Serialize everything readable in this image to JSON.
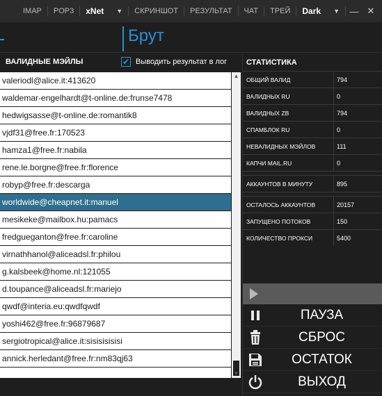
{
  "topbar": {
    "items": [
      "IMAP",
      "POP3"
    ],
    "selected_app": "xNet",
    "items2": [
      "СКРИНШОТ",
      "РЕЗУЛЬТАТ",
      "ЧАТ",
      "ТРЕЙ"
    ],
    "theme": "Dark",
    "minimize": "—",
    "close": "✕"
  },
  "header": {
    "title": "Брут"
  },
  "left": {
    "label": "ВАЛИДНЫЕ МЭЙЛЫ",
    "checkbox_label": "Выводить результат в лог",
    "checkbox_checked": true,
    "rows": [
      "valeriodl@alice.it:413620",
      "waldemar-engelhardt@t-online.de:frunse7478",
      "hedwigsasse@t-online.de:romantik8",
      "vjdf31@free.fr:170523",
      "hamza1@free.fr:nabila",
      "rene.le.borgne@free.fr:florence",
      "robyp@free.fr:descarga",
      "worldwide@cheapnet.it:manuel",
      "mesikeke@mailbox.hu:pamacs",
      "fredgueganton@free.fr:caroline",
      "virnathhanol@aliceadsl.fr:philou",
      "g.kalsbeek@home.nl:121055",
      "d.toupance@aliceadsl.fr:mariejo",
      "qwdf@interia.eu:qwdfqwdf",
      "yoshi462@free.fr:96879687",
      "sergiotropical@alice.it:sisisisisisi",
      "annick.herledant@free.fr:nm83qj63"
    ],
    "selected_index": 7
  },
  "stats": {
    "title": "СТАТИСТИКА",
    "items": [
      {
        "k": "ОБЩИЙ ВАЛИД",
        "v": "794"
      },
      {
        "k": "ВАЛИДНЫХ RU",
        "v": "0"
      },
      {
        "k": "ВАЛИДНЫХ ZB",
        "v": "794"
      },
      {
        "k": "СПАМБЛОК RU",
        "v": "0"
      },
      {
        "k": "НЕВАЛИДНЫХ МЭЙЛОВ",
        "v": "111"
      },
      {
        "k": "КАПЧИ MAIL.RU",
        "v": "0"
      }
    ],
    "items2": [
      {
        "k": "АККАУНТОВ В МИНУТУ",
        "v": "895"
      }
    ],
    "items3": [
      {
        "k": "ОСТАЛОСЬ АККАУНТОВ",
        "v": "20157"
      },
      {
        "k": "ЗАПУЩЕНО ПОТОКОВ",
        "v": "150"
      },
      {
        "k": "КОЛИЧЕСТВО ПРОКСИ",
        "v": "5400"
      }
    ]
  },
  "buttons": {
    "pause": "ПАУЗА",
    "reset": "СБРОС",
    "remainder": "ОСТАТОК",
    "exit": "ВЫХОД"
  },
  "colors": {
    "accent": "#2a8fd6",
    "selected_row": "#2e6e8e"
  }
}
